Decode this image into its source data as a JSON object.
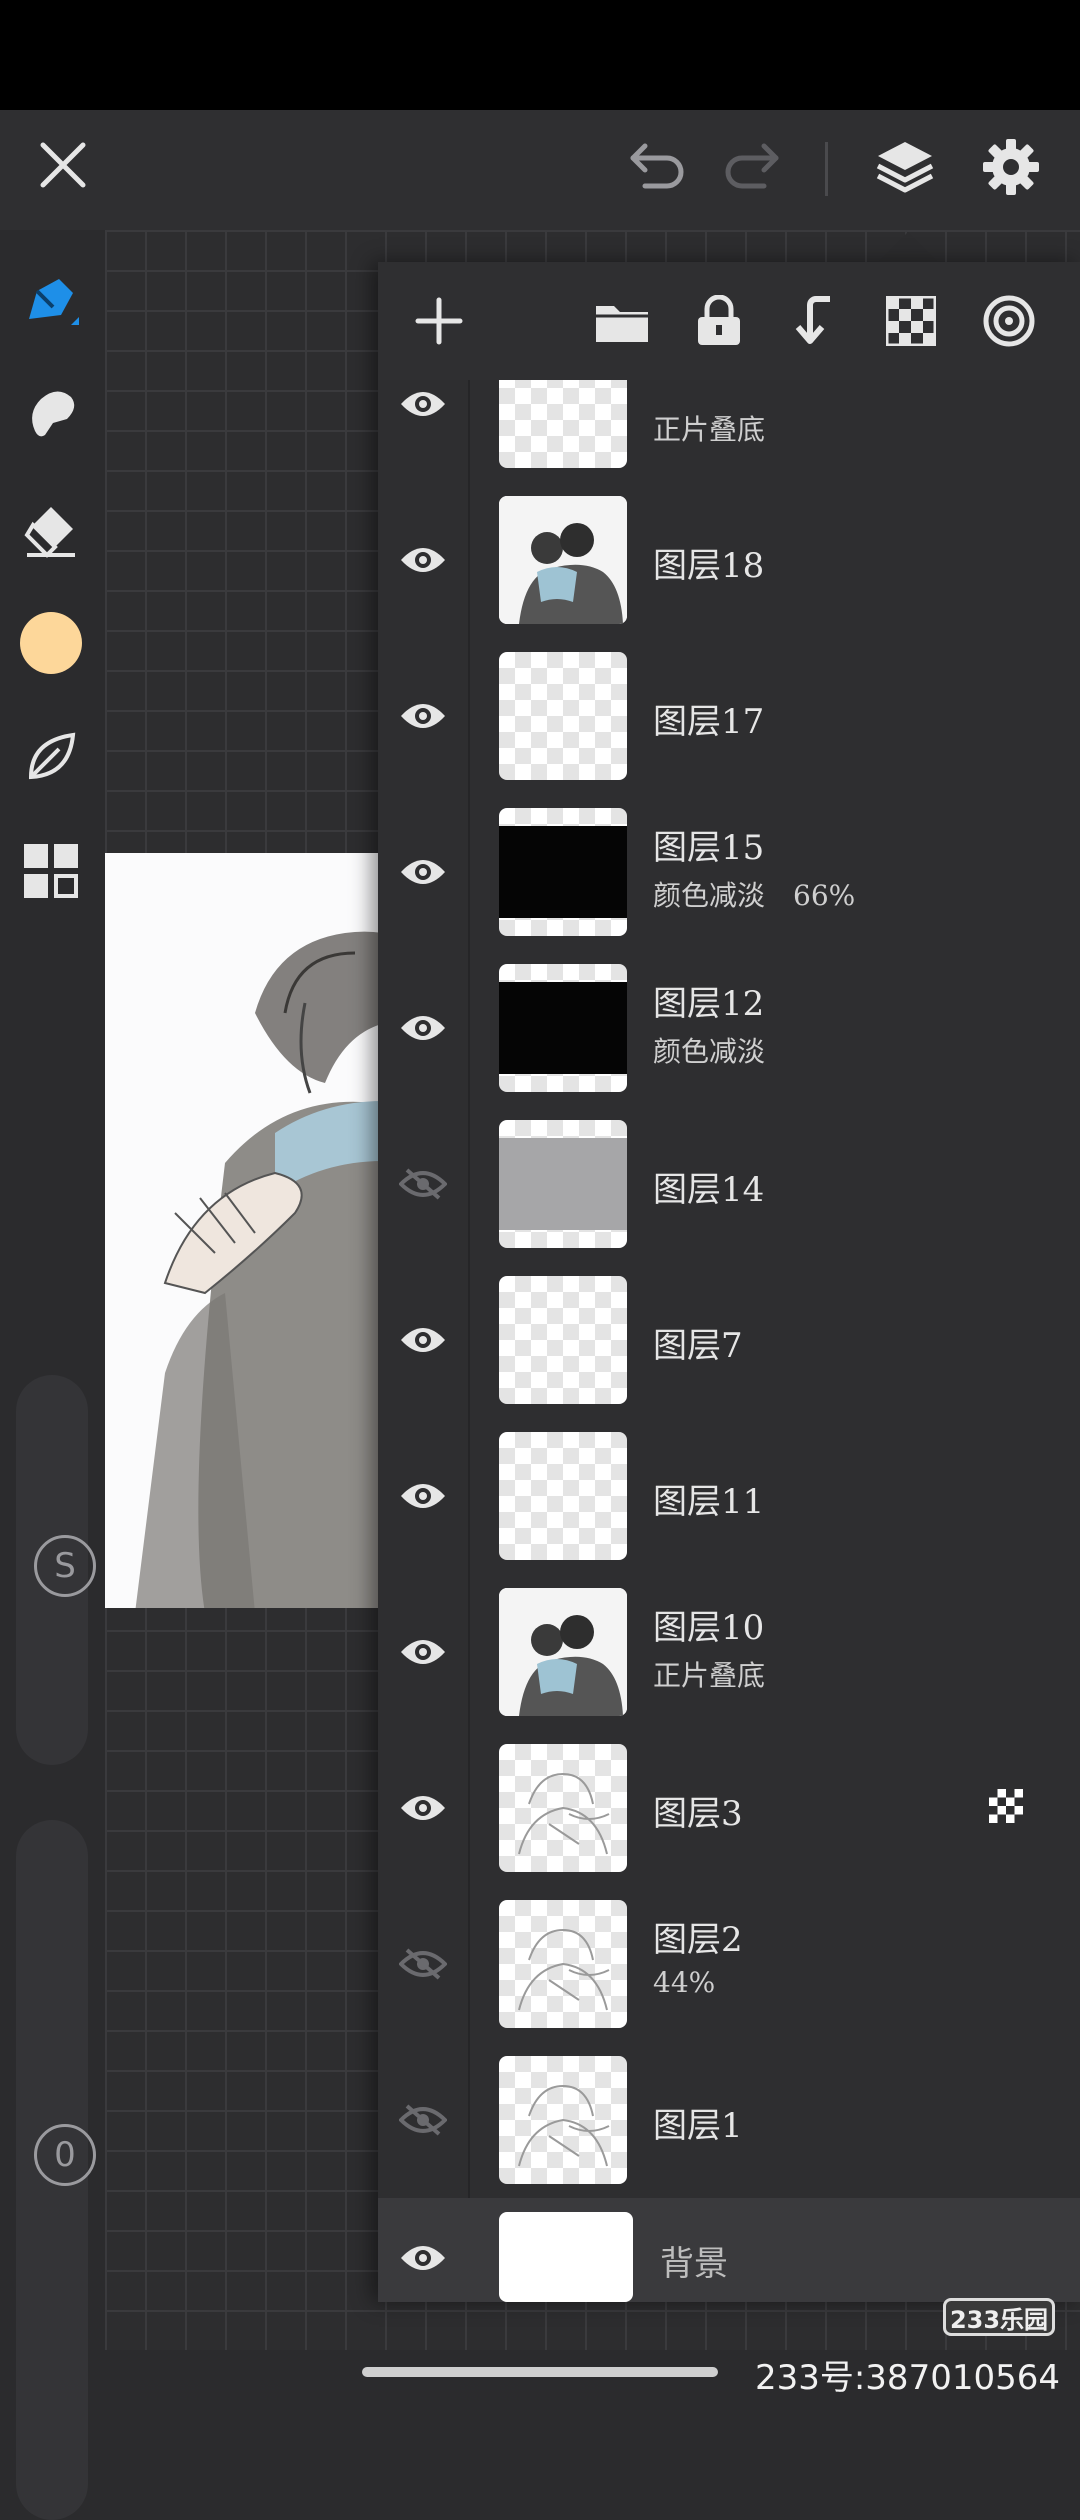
{
  "topbar": {
    "close_icon": "close-icon",
    "undo_icon": "undo-icon",
    "redo_icon": "redo-icon",
    "layers_icon": "layers-icon",
    "settings_icon": "gear-icon"
  },
  "tools": [
    {
      "name": "pen-tool",
      "icon": "pen-icon",
      "active": true,
      "accent": "#1e8fe8"
    },
    {
      "name": "smudge-tool",
      "icon": "smudge-icon"
    },
    {
      "name": "eraser-tool",
      "icon": "eraser-icon"
    },
    {
      "name": "color-swatch",
      "color": "#fdd79a"
    },
    {
      "name": "leaf-tool",
      "icon": "leaf-icon"
    },
    {
      "name": "grid-menu",
      "icon": "grid-icon"
    }
  ],
  "sliders": {
    "size_label": "S",
    "opacity_label": "0"
  },
  "layer_toolbar": {
    "add": "plus-icon",
    "folder": "folder-icon",
    "lock": "lock-icon",
    "merge_down": "merge-down-icon",
    "transparency": "checker-icon",
    "reference": "target-icon"
  },
  "layers": [
    {
      "name": "",
      "sub": "正片叠底",
      "visible": true,
      "thumb": "checker"
    },
    {
      "name": "图层18",
      "sub": "",
      "visible": true,
      "thumb": "art"
    },
    {
      "name": "图层17",
      "sub": "",
      "visible": true,
      "thumb": "checker"
    },
    {
      "name": "图层15",
      "sub": "颜色减淡　66%",
      "visible": true,
      "thumb": "dark"
    },
    {
      "name": "图层12",
      "sub": "颜色减淡",
      "visible": true,
      "thumb": "dark"
    },
    {
      "name": "图层14",
      "sub": "",
      "visible": false,
      "thumb": "gray"
    },
    {
      "name": "图层7",
      "sub": "",
      "visible": true,
      "thumb": "checker"
    },
    {
      "name": "图层11",
      "sub": "",
      "visible": true,
      "thumb": "checker"
    },
    {
      "name": "图层10",
      "sub": "正片叠底",
      "visible": true,
      "thumb": "art"
    },
    {
      "name": "图层3",
      "sub": "",
      "visible": true,
      "thumb": "sketch",
      "alpha_lock": true
    },
    {
      "name": "图层2",
      "sub": "44%",
      "visible": false,
      "thumb": "sketch"
    },
    {
      "name": "图层1",
      "sub": "",
      "visible": false,
      "thumb": "sketch"
    },
    {
      "name": "背景",
      "sub": "",
      "visible": true,
      "thumb": "white",
      "selected": true
    }
  ],
  "watermark": {
    "logo": "233乐园",
    "id": "233号:387010564"
  }
}
